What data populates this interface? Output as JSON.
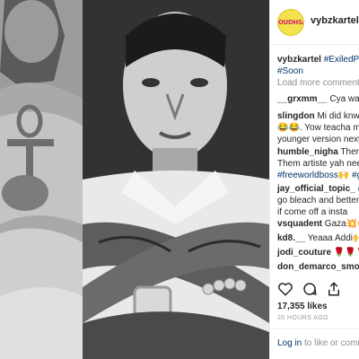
{
  "post": {
    "username": "vybzkartel",
    "avatar_text": "OUDHSA",
    "caption": {
      "user": "vybzkartel",
      "text_line1": "#ExiledPha",
      "text_line2": "#Soon"
    },
    "load_more": "Load more comments",
    "comments": [
      {
        "user": "__grxmm__",
        "text": "Cya wait"
      },
      {
        "user": "slingdon",
        "text": "Mi did knw s"
      },
      {
        "user": "",
        "text": "😂😂. Yow teacha mi"
      },
      {
        "user": "",
        "text": "younger version next"
      },
      {
        "user": "humble_nigha",
        "text": "Them r"
      },
      {
        "user": "",
        "text": "Them artiste yah need"
      },
      {
        "user": "",
        "text": "#freeworldboss🙌 #g"
      },
      {
        "user": "jay_official_topic_",
        "text": "@g"
      },
      {
        "user": "",
        "text": "go bleach and better t"
      },
      {
        "user": "",
        "text": "if come off a insta"
      },
      {
        "user": "vsquadent",
        "text": "Gaza💥🙌"
      },
      {
        "user": "kd8.__",
        "text": "Yeaaa Addi🙌"
      },
      {
        "user": "jodi_couture",
        "text": "🌹🌹🌹"
      },
      {
        "user": "don_demarco_smooth",
        "text": ""
      }
    ],
    "likes": "17,355 likes",
    "time_ago": "20 HOURS AGO",
    "login_link": "Log in",
    "login_rest": "to like or commen"
  },
  "icons": [
    "heart-icon",
    "comment-icon",
    "share-icon"
  ]
}
